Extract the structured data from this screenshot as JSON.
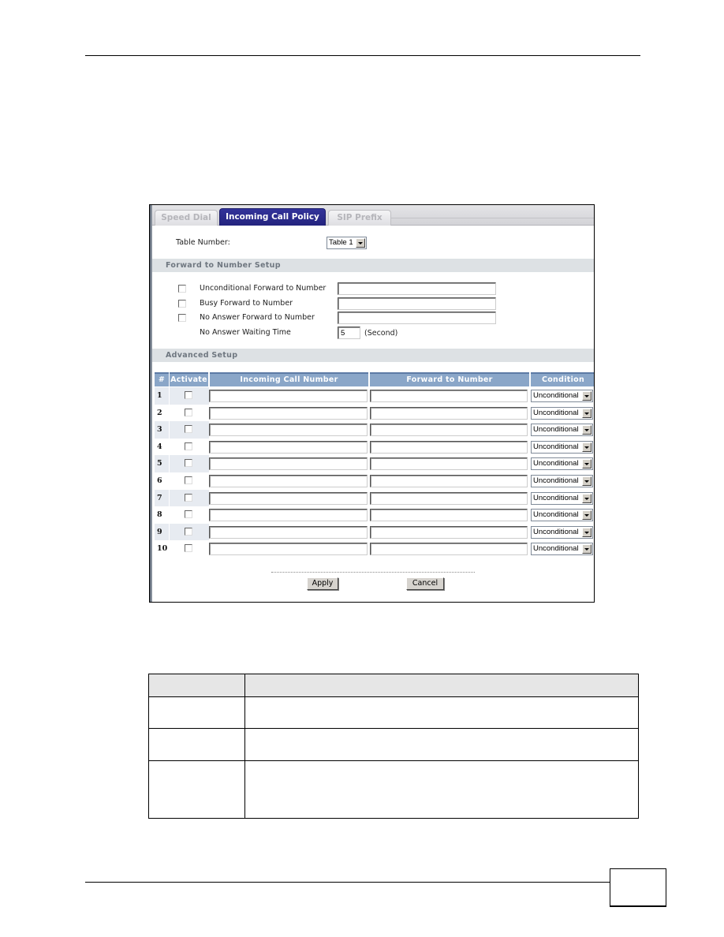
{
  "tabs": [
    {
      "label": "Speed Dial",
      "active": false
    },
    {
      "label": "Incoming Call Policy",
      "active": true
    },
    {
      "label": "SIP Prefix",
      "active": false
    }
  ],
  "table_number": {
    "label": "Table Number:",
    "selected": "Table 1"
  },
  "forward_setup": {
    "title": "Forward to Number Setup",
    "unconditional": {
      "label": "Unconditional Forward to Number",
      "checked": false,
      "value": ""
    },
    "busy": {
      "label": "Busy Forward to Number",
      "checked": false,
      "value": ""
    },
    "no_answer": {
      "label": "No Answer Forward to Number",
      "checked": false,
      "value": ""
    },
    "waiting_time": {
      "label": "No Answer Waiting Time",
      "value": "5",
      "unit": "(Second)"
    }
  },
  "advanced_setup": {
    "title": "Advanced Setup",
    "columns": [
      "#",
      "Activate",
      "Incoming Call Number",
      "Forward to Number",
      "Condition"
    ],
    "rows": [
      {
        "index": "1",
        "active": false,
        "incoming": "",
        "forward": "",
        "condition": "Unconditional"
      },
      {
        "index": "2",
        "active": false,
        "incoming": "",
        "forward": "",
        "condition": "Unconditional"
      },
      {
        "index": "3",
        "active": false,
        "incoming": "",
        "forward": "",
        "condition": "Unconditional"
      },
      {
        "index": "4",
        "active": false,
        "incoming": "",
        "forward": "",
        "condition": "Unconditional"
      },
      {
        "index": "5",
        "active": false,
        "incoming": "",
        "forward": "",
        "condition": "Unconditional"
      },
      {
        "index": "6",
        "active": false,
        "incoming": "",
        "forward": "",
        "condition": "Unconditional"
      },
      {
        "index": "7",
        "active": false,
        "incoming": "",
        "forward": "",
        "condition": "Unconditional"
      },
      {
        "index": "8",
        "active": false,
        "incoming": "",
        "forward": "",
        "condition": "Unconditional"
      },
      {
        "index": "9",
        "active": false,
        "incoming": "",
        "forward": "",
        "condition": "Unconditional"
      },
      {
        "index": "10",
        "active": false,
        "incoming": "",
        "forward": "",
        "condition": "Unconditional"
      }
    ]
  },
  "buttons": {
    "apply": "Apply",
    "cancel": "Cancel"
  },
  "description_table": {
    "header": [
      "",
      ""
    ],
    "rows": [
      [
        "",
        ""
      ],
      [
        "",
        ""
      ],
      [
        "",
        ""
      ]
    ]
  },
  "page_number": ""
}
